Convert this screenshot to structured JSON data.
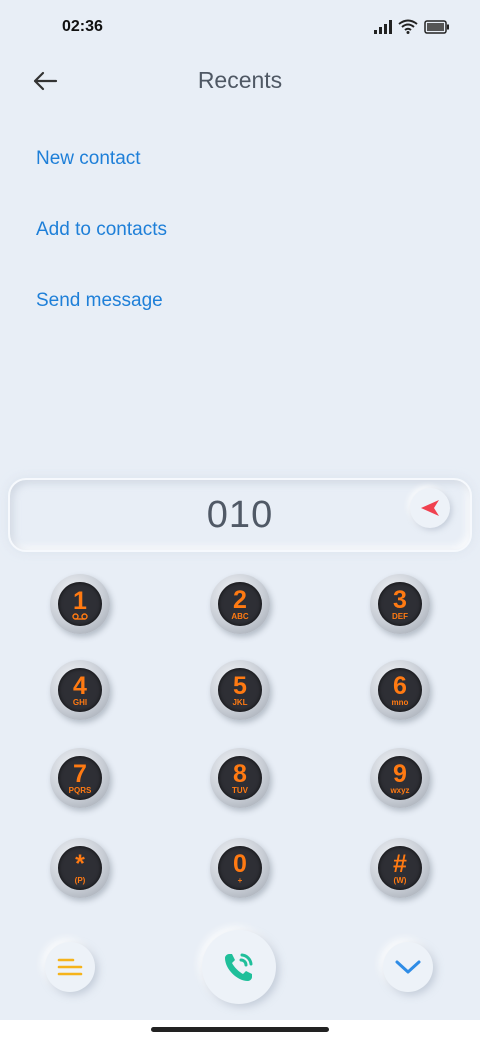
{
  "status_bar": {
    "time": "02:36",
    "icons": [
      "signal-icon",
      "wifi-icon",
      "battery-icon"
    ]
  },
  "header": {
    "title": "Recents",
    "back_icon": "arrow-left-icon"
  },
  "actions": {
    "new_contact": "New contact",
    "add_to_contacts": "Add to contacts",
    "send_message": "Send message"
  },
  "dialer": {
    "number": "010",
    "backspace_icon": "backspace-icon",
    "keys": [
      {
        "digit": "1",
        "letters": "",
        "icon": "voicemail-icon"
      },
      {
        "digit": "2",
        "letters": "ABC"
      },
      {
        "digit": "3",
        "letters": "DEF"
      },
      {
        "digit": "4",
        "letters": "GHI"
      },
      {
        "digit": "5",
        "letters": "JKL"
      },
      {
        "digit": "6",
        "letters": "mno"
      },
      {
        "digit": "7",
        "letters": "PQRS"
      },
      {
        "digit": "8",
        "letters": "TUV"
      },
      {
        "digit": "9",
        "letters": "wxyz"
      },
      {
        "digit": "*",
        "letters": "(P)"
      },
      {
        "digit": "0",
        "letters": "+"
      },
      {
        "digit": "#",
        "letters": "(W)"
      }
    ]
  },
  "bottom_bar": {
    "menu_icon": "menu-icon",
    "call_icon": "phone-call-icon",
    "collapse_icon": "chevron-down-icon"
  },
  "colors": {
    "background": "#e8eef6",
    "link": "#1e7fd8",
    "key_text": "#ff7a12",
    "call": "#1fbf9a",
    "backspace": "#f0404f",
    "menu": "#f5b31b",
    "chevron": "#2e8ce6"
  }
}
